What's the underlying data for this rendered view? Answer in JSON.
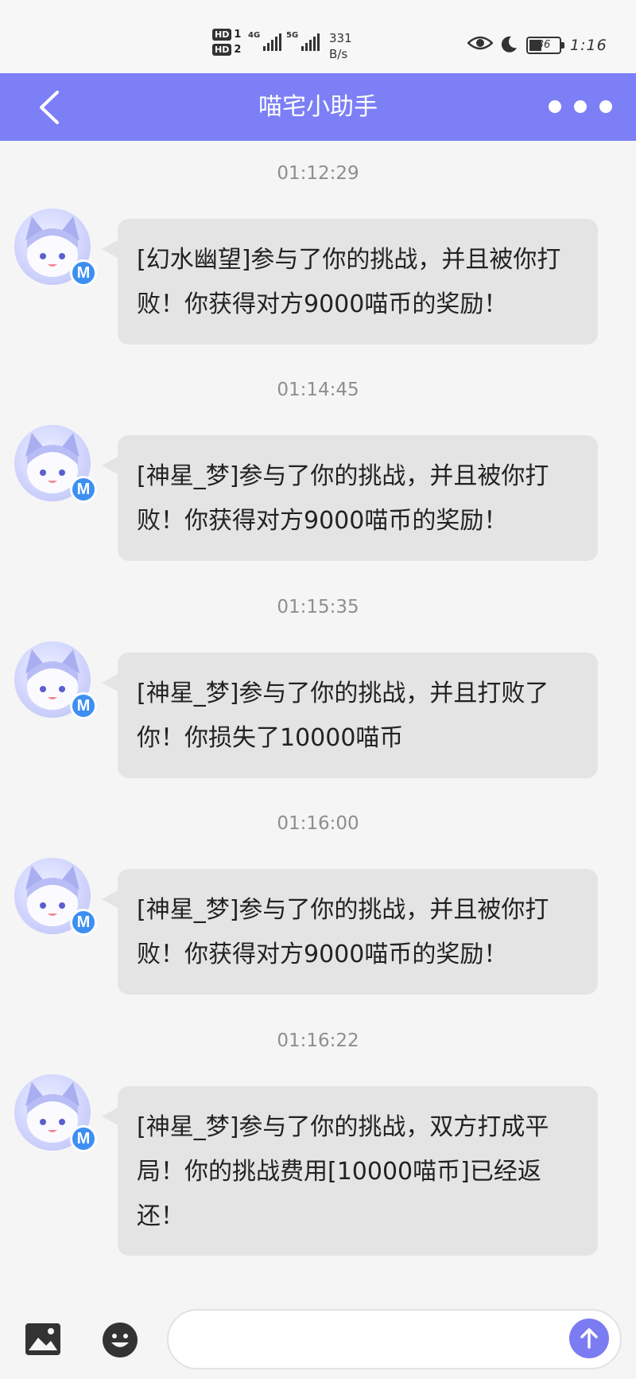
{
  "status_bar": {
    "hd1": "HD",
    "hd1_num": "1",
    "hd2": "HD",
    "hd2_num": "2",
    "net1": "4G",
    "net2": "5G",
    "speed_value": "331",
    "speed_unit": "B/s",
    "battery": "36",
    "time": "1:16"
  },
  "header": {
    "title": "喵宅小助手"
  },
  "avatar_badge": "M",
  "messages": [
    {
      "time": "01:12:29",
      "text": "[幻水幽望]参与了你的挑战，并且被你打败！你获得对方9000喵币的奖励！"
    },
    {
      "time": "01:14:45",
      "text": "[神星_梦]参与了你的挑战，并且被你打败！你获得对方9000喵币的奖励！"
    },
    {
      "time": "01:15:35",
      "text": "[神星_梦]参与了你的挑战，并且打败了你！你损失了10000喵币"
    },
    {
      "time": "01:16:00",
      "text": "[神星_梦]参与了你的挑战，并且被你打败！你获得对方9000喵币的奖励！"
    },
    {
      "time": "01:16:22",
      "text": "[神星_梦]参与了你的挑战，双方打成平局！你的挑战费用[10000喵币]已经返还！"
    }
  ],
  "composer": {
    "value": "",
    "placeholder": ""
  },
  "icons": {
    "back": "back-arrow-icon",
    "more": "more-dots-icon",
    "image": "image-icon",
    "emoji": "emoji-icon",
    "send": "send-arrow-icon"
  },
  "colors": {
    "header_bg": "#7c7ff6",
    "bubble_bg": "#e4e4e4",
    "badge": "#3d8ff2",
    "send_bg": "#7b7cf2"
  }
}
